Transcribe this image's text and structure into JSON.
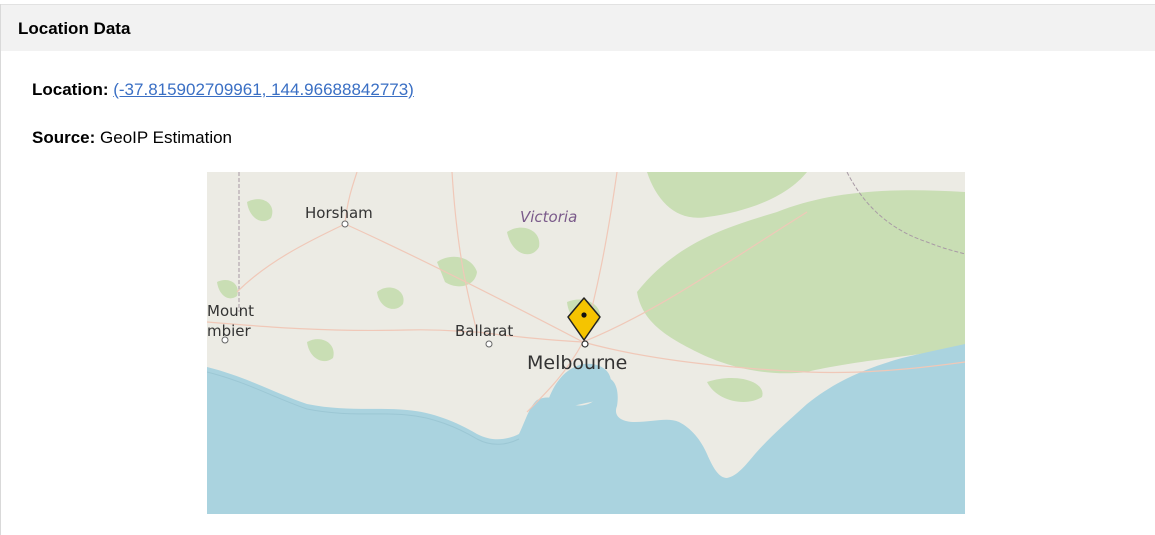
{
  "panel": {
    "title": "Location Data"
  },
  "location": {
    "label": "Location:",
    "coordinates_text": "(-37.815902709961, 144.96688842773)",
    "latitude": -37.815902709961,
    "longitude": 144.96688842773
  },
  "source": {
    "label": "Source:",
    "value": "GeoIP Estimation"
  },
  "map": {
    "places": {
      "horsham": "Horsham",
      "victoria": "Victoria",
      "mount": "Mount",
      "gambier_partial": "mbier",
      "ballarat": "Ballarat",
      "melbourne": "Melbourne"
    },
    "marker_icon": "map-pin-icon",
    "colors": {
      "land": "#ecebe4",
      "forest": "#c9deb4",
      "water": "#aad3df",
      "marker": "#f5c400",
      "link": "#3a6fc4"
    }
  }
}
